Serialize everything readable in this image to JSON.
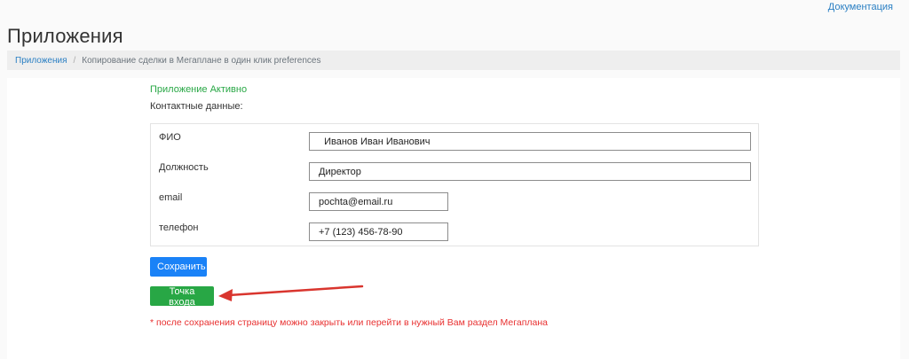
{
  "header": {
    "doc_link": "Документация",
    "title": "Приложения"
  },
  "breadcrumb": {
    "root": "Приложения",
    "separator": "/",
    "current": "Копирование сделки в Мегаплане в один клик preferences"
  },
  "main": {
    "status": "Приложение Активно",
    "contacts_label": "Контактные данные:",
    "fields": [
      {
        "label": "ФИО",
        "value": "  Иванов Иван Иванович"
      },
      {
        "label": "Должность",
        "value": "Директор"
      },
      {
        "label": "email",
        "value": "pochta@email.ru"
      },
      {
        "label": "телефон",
        "value": "+7 (123) 456-78-90"
      }
    ],
    "save_button": "Сохранить",
    "entry_button": "Точка входа",
    "note": "* после сохранения страницу можно закрыть или перейти в нужный Вам раздел Мегаплана"
  },
  "colors": {
    "status": "#28a745",
    "save": "#1a82f7",
    "entry": "#28a745",
    "note": "#e83030",
    "arrow": "#d9352e"
  }
}
